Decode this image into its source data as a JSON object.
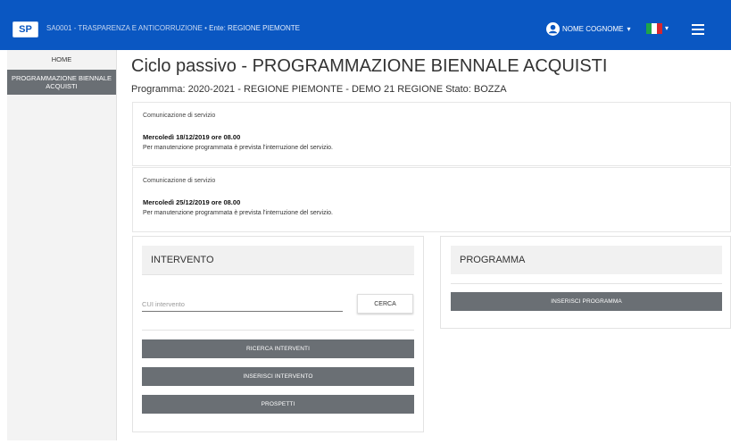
{
  "header": {
    "logo": "SP",
    "title": "SA0001 - TRASPARENZA E ANTICORRUZIONE",
    "ente": "Ente: REGIONE PIEMONTE",
    "user_name": "NOME COGNOME",
    "user_caret": "▾",
    "flag_caret": "▾",
    "colors": {
      "bar": "#0a57c2",
      "flag_green": "#1ea54a",
      "flag_white": "#ffffff",
      "flag_red": "#d7262e"
    }
  },
  "sidebar": {
    "items": [
      {
        "label": "HOME"
      },
      {
        "label": "PROGRAMMAZIONE BIENNALE ACQUISTI",
        "active": true
      }
    ]
  },
  "main": {
    "title": "Ciclo passivo - PROGRAMMAZIONE BIENNALE ACQUISTI",
    "subtitle": "Programma: 2020-2021 - REGIONE PIEMONTE - DEMO 21 REGIONE Stato: BOZZA"
  },
  "notices": [
    {
      "heading": "Comunicazione di servizio",
      "date": "Mercoledì 18/12/2019 ore 08.00",
      "text": "Per manutenzione programmata è prevista l'interruzione del servizio."
    },
    {
      "heading": "Comunicazione di servizio",
      "date": "Mercoledì 25/12/2019 ore 08.00",
      "text": "Per manutenzione programmata è prevista l'interruzione del servizio."
    }
  ],
  "intervento": {
    "title": "INTERVENTO",
    "cui_placeholder": "CUI intervento",
    "cui_value": "",
    "search_label": "CERCA",
    "buttons": [
      "RICERCA INTERVENTI",
      "INSERISCI INTERVENTO",
      "PROSPETTI"
    ]
  },
  "programma": {
    "title": "PROGRAMMA",
    "button": "INSERISCI PROGRAMMA"
  }
}
